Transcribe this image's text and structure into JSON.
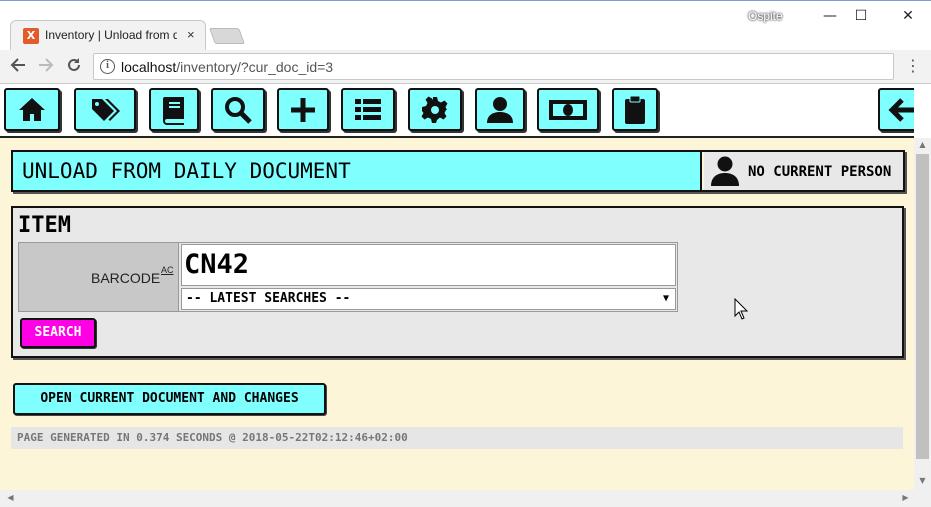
{
  "browser": {
    "tab_title": "Inventory | Unload from d",
    "tab_close": "×",
    "user_label": "Ospite",
    "window_controls": {
      "minimize": "—",
      "maximize": "☐",
      "close": "✕"
    },
    "url_host": "localhost",
    "url_path": "/inventory/?cur_doc_id=3",
    "favicon_letter": "X",
    "menu_icon": "⋮"
  },
  "app_nav": {
    "buttons": [
      {
        "icon": "home-icon"
      },
      {
        "icon": "tags-icon"
      },
      {
        "icon": "book-icon"
      },
      {
        "icon": "search-icon"
      },
      {
        "icon": "plus-icon"
      },
      {
        "icon": "list-icon"
      },
      {
        "icon": "gear-icon"
      },
      {
        "icon": "user-icon"
      },
      {
        "icon": "money-icon"
      },
      {
        "icon": "clipboard-icon"
      },
      {
        "icon": "arrow-left-icon"
      }
    ],
    "accent_color": "#80ffff"
  },
  "header": {
    "title": "UNLOAD FROM DAILY DOCUMENT",
    "person_label": "NO CURRENT PERSON"
  },
  "item": {
    "section_title": "ITEM",
    "barcode_label": "BARCODE",
    "ac_link": "AC",
    "barcode_value": "CN42",
    "latest_searches": "-- LATEST SEARCHES --",
    "search_button": "SEARCH",
    "search_color": "#ff00e6"
  },
  "actions": {
    "open_doc_button": "OPEN CURRENT DOCUMENT AND CHANGES"
  },
  "footer": {
    "generated": "PAGE GENERATED IN 0.374 SECONDS @ 2018-05-22T02:12:46+02:00"
  }
}
